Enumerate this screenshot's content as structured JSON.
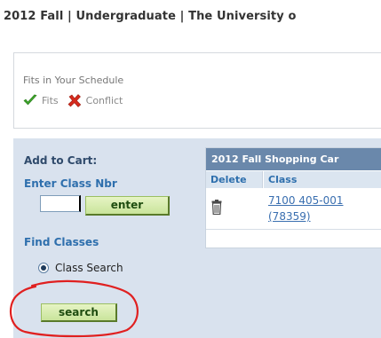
{
  "header": {
    "term_title": "2012 Fall | Undergraduate | The University o"
  },
  "legend": {
    "title": "Fits in Your Schedule",
    "fits_label": "Fits",
    "conflict_label": "Conflict",
    "fits_icon": "green-check-icon",
    "conflict_icon": "red-x-icon",
    "fits_color": "#3ea52b",
    "conflict_color": "#d52b1e"
  },
  "left_panel": {
    "add_to_cart_label": "Add to Cart:",
    "enter_class_nbr_label": "Enter Class Nbr",
    "class_nbr_value": "",
    "enter_button_label": "enter",
    "find_classes_label": "Find Classes",
    "class_search_option_label": "Class Search",
    "class_search_selected": true,
    "search_button_label": "search",
    "annotation_color": "#e02020"
  },
  "cart": {
    "title": "2012 Fall Shopping Car",
    "columns": [
      "Delete",
      "Class"
    ],
    "rows": [
      {
        "delete_icon": "trash-icon",
        "class_section": "7100 405-001",
        "class_nbr": "(78359)"
      }
    ]
  }
}
